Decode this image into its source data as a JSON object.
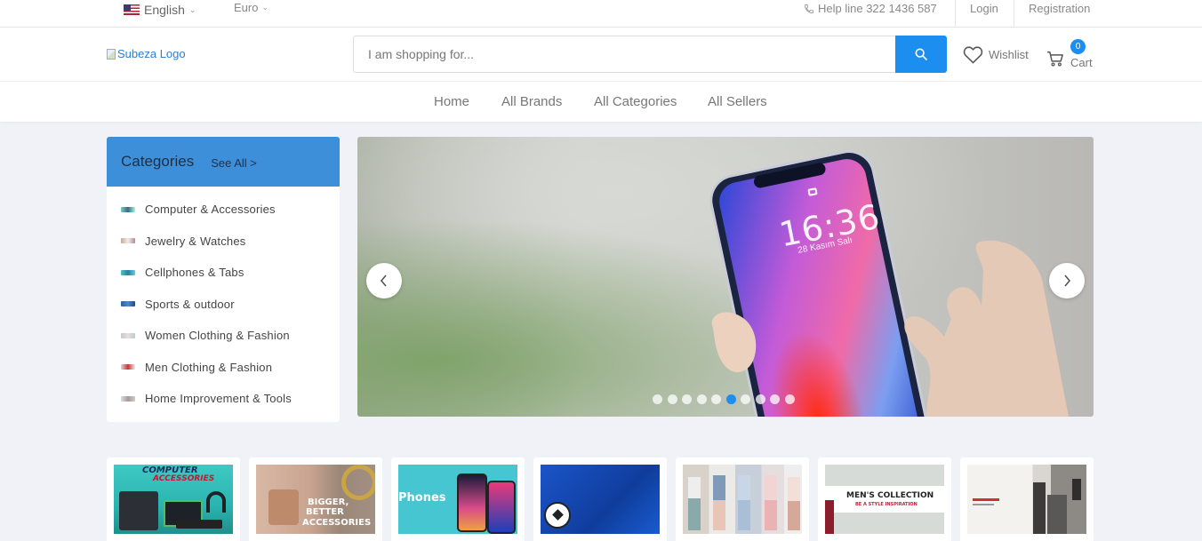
{
  "topbar": {
    "language": "English",
    "currency": "Euro",
    "helpline": "Help line 322 1436 587",
    "login": "Login",
    "registration": "Registration"
  },
  "header": {
    "logo_alt": "Subeza Logo",
    "search_placeholder": "I am shopping for...",
    "wishlist": "Wishlist",
    "cart_label": "Cart",
    "cart_count": "0"
  },
  "nav": [
    "Home",
    "All Brands",
    "All Categories",
    "All Sellers"
  ],
  "categories": {
    "title": "Categories",
    "see_all": "See All >",
    "items": [
      "Computer & Accessories",
      "Jewelry & Watches",
      "Cellphones & Tabs",
      "Sports & outdoor",
      "Women Clothing & Fashion",
      "Men Clothing & Fashion",
      "Home Improvement & Tools"
    ]
  },
  "slider": {
    "lock_time": "16:36",
    "lock_date": "28 Kasım Salı",
    "dot_count": 10,
    "active_dot": 6
  },
  "tiles": {
    "computer_line1": "COMPUTER",
    "computer_line2": "ACCESSORIES",
    "jewelry_line1": "BIGGER,",
    "jewelry_line2": "BETTER",
    "jewelry_line3": "ACCESSORIES",
    "phones": "Phones",
    "men_title": "MEN'S COLLECTION",
    "men_sub": "BE A STYLE INSPIRATION"
  },
  "colors": {
    "accent": "#1b8ef0",
    "category_header": "#3d8fd9"
  }
}
